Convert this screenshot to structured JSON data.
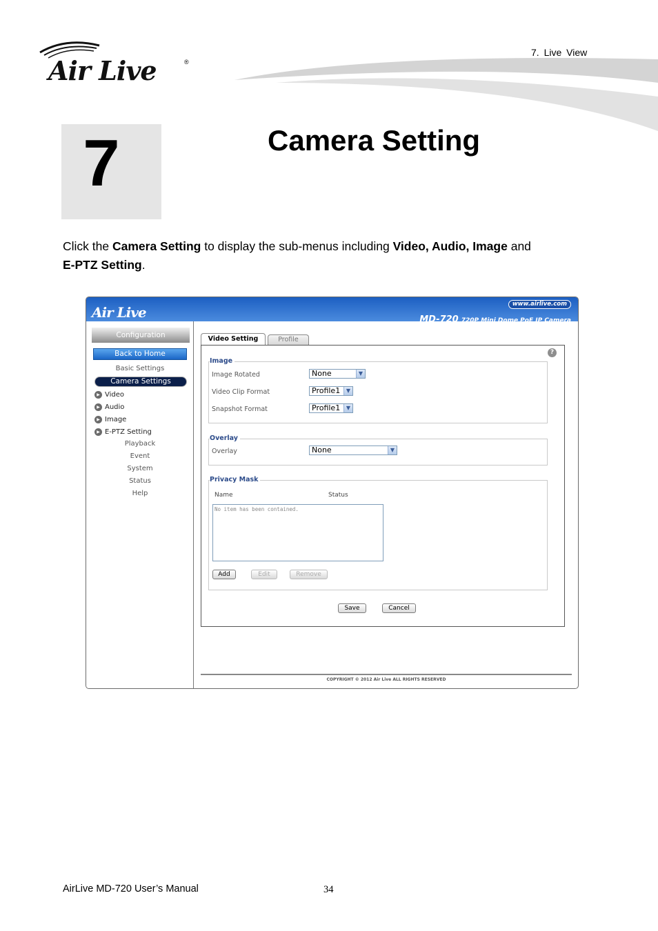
{
  "header": {
    "logo_text": "Air Live",
    "registered_mark": "®",
    "section_label": "7. Live View"
  },
  "chapter": {
    "number": "7",
    "title": "Camera Setting"
  },
  "intro": {
    "t1": "Click the ",
    "b1": "Camera Setting",
    "t2": " to display the sub-menus including ",
    "b2": "Video, Audio, Image",
    "t3": " and ",
    "b3": "E-PTZ Setting",
    "t4": "."
  },
  "screenshot": {
    "top_bar": {
      "logo_text": "Air Live",
      "url_badge": "www.airlive.com",
      "model": "MD-720",
      "model_desc": "720P Mini Dome PoE IP Camera"
    },
    "sidebar": {
      "config_header": "Configuration",
      "back_home": "Back to Home",
      "basic_settings": "Basic Settings",
      "camera_settings": "Camera Settings",
      "sub_items": [
        "Video",
        "Audio",
        "Image",
        "E-PTZ Setting"
      ],
      "bottom_links": [
        "Playback",
        "Event",
        "System",
        "Status",
        "Help"
      ]
    },
    "tabs": {
      "active": "Video Setting",
      "inactive": "Profile"
    },
    "image_section": {
      "legend": "Image",
      "rotated_label": "Image Rotated",
      "rotated_value": "None",
      "clip_label": "Video Clip Format",
      "clip_value": "Profile1",
      "snapshot_label": "Snapshot Format",
      "snapshot_value": "Profile1"
    },
    "overlay_section": {
      "legend": "Overlay",
      "label": "Overlay",
      "value": "None"
    },
    "privacy_section": {
      "legend": "Privacy Mask",
      "col_name": "Name",
      "col_status": "Status",
      "empty_text": "No item has been contained.",
      "add": "Add",
      "edit": "Edit",
      "remove": "Remove"
    },
    "buttons": {
      "save": "Save",
      "cancel": "Cancel"
    },
    "copyright": "COPYRIGHT © 2012 Air Live ALL RIGHTS RESERVED"
  },
  "footer": {
    "manual": "AirLive MD-720 User’s Manual",
    "page": "34"
  }
}
